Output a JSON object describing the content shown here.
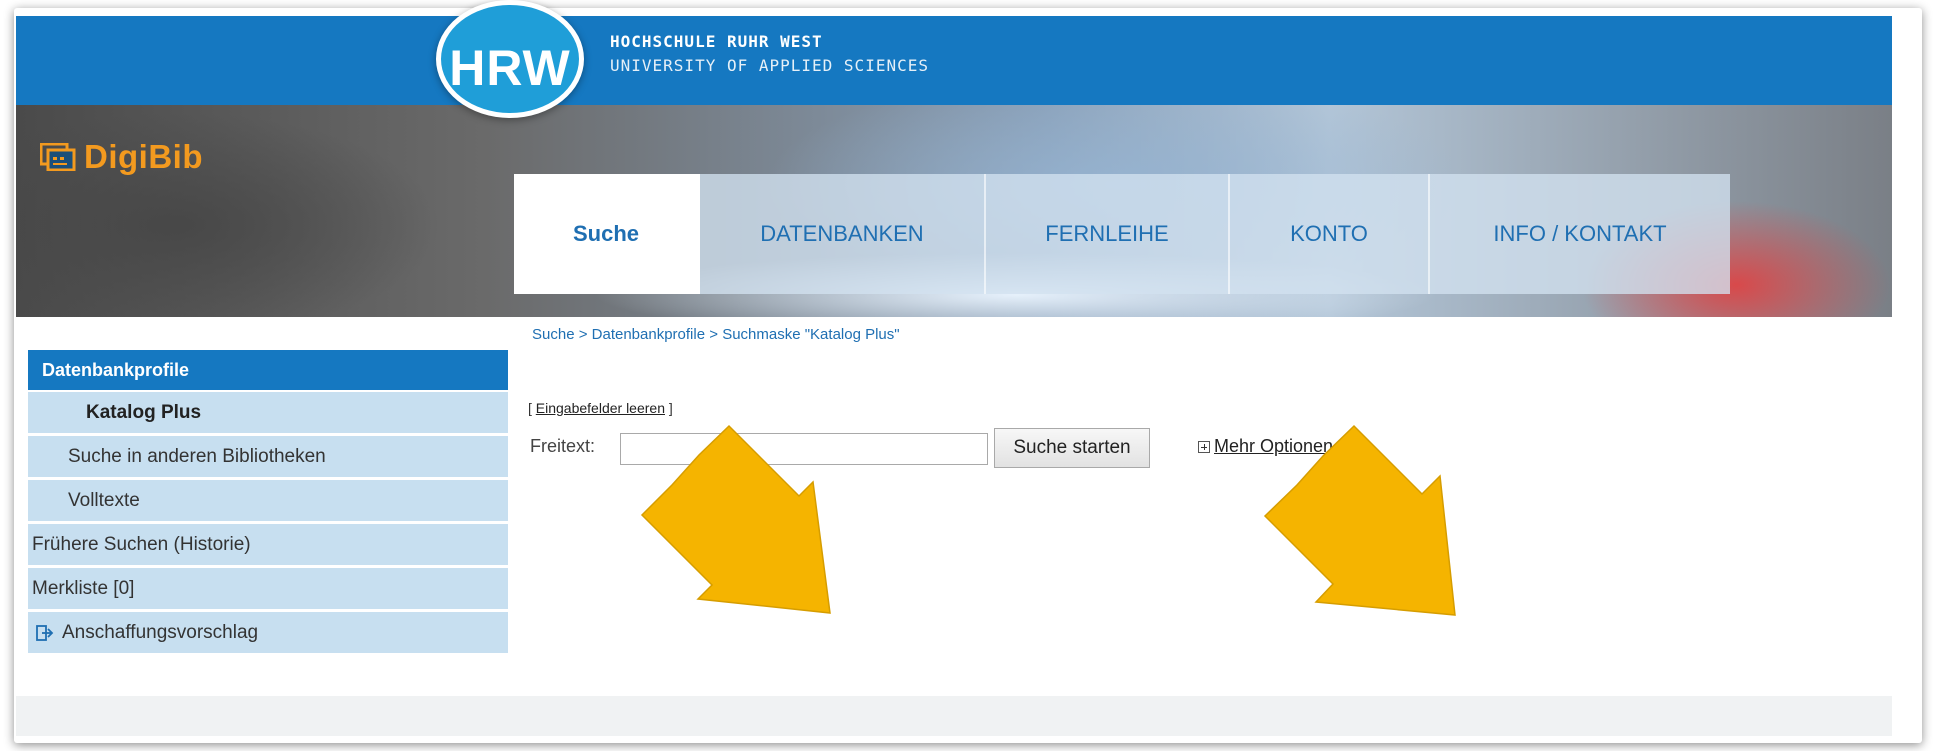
{
  "header": {
    "logo": "HRW",
    "school_name": "HOCHSCHULE RUHR WEST",
    "school_sub": "UNIVERSITY OF APPLIED SCIENCES",
    "app_name": "DigiBib"
  },
  "nav": {
    "tabs": [
      {
        "label": "Suche",
        "active": true
      },
      {
        "label": "DATENBANKEN"
      },
      {
        "label": "FERNLEIHE"
      },
      {
        "label": "KONTO"
      },
      {
        "label": "INFO / KONTAKT"
      }
    ]
  },
  "breadcrumb": {
    "items": [
      "Suche",
      "Datenbankprofile",
      "Suchmaske \"Katalog Plus\""
    ],
    "separator": ">"
  },
  "sidebar": {
    "header": "Datenbankprofile",
    "items": [
      {
        "label": "Katalog Plus",
        "level": 2
      },
      {
        "label": "Suche in anderen Bibliotheken",
        "level": 1
      },
      {
        "label": "Volltexte",
        "level": 1
      },
      {
        "label": "Frühere Suchen (Historie)",
        "level": 0
      },
      {
        "label": "Merkliste [0]",
        "level": 0
      },
      {
        "label": "Anschaffungsvorschlag",
        "level": 0,
        "icon": "external-link-icon"
      }
    ]
  },
  "form": {
    "clear_open": "[",
    "clear_link": "Eingabefelder leeren",
    "clear_close": "]",
    "freitext_label": "Freitext:",
    "freitext_value": "",
    "search_button": "Suche starten",
    "more_options": "Mehr Optionen"
  },
  "colors": {
    "primary": "#1578c1",
    "sidebar_bg": "#c7dff0",
    "brand_orange": "#f39a1f",
    "arrow": "#f5b400"
  }
}
